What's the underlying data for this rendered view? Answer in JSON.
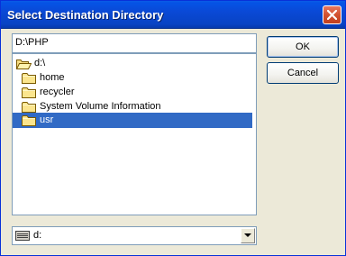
{
  "window": {
    "title": "Select Destination Directory"
  },
  "path_field": {
    "value": "D:\\PHP"
  },
  "buttons": {
    "ok": "OK",
    "cancel": "Cancel"
  },
  "tree": {
    "items": [
      {
        "label": "d:\\",
        "icon": "open-folder-icon",
        "selected": false
      },
      {
        "label": "home",
        "icon": "folder-icon",
        "selected": false
      },
      {
        "label": "recycler",
        "icon": "folder-icon",
        "selected": false
      },
      {
        "label": "System Volume Information",
        "icon": "folder-icon",
        "selected": false
      },
      {
        "label": "usr",
        "icon": "folder-icon",
        "selected": true
      }
    ]
  },
  "drive": {
    "selected": "d:",
    "icon": "drive-icon"
  },
  "colors": {
    "titlebar": "#0a49d6",
    "selection": "#316ac5",
    "close": "#d2512f"
  }
}
